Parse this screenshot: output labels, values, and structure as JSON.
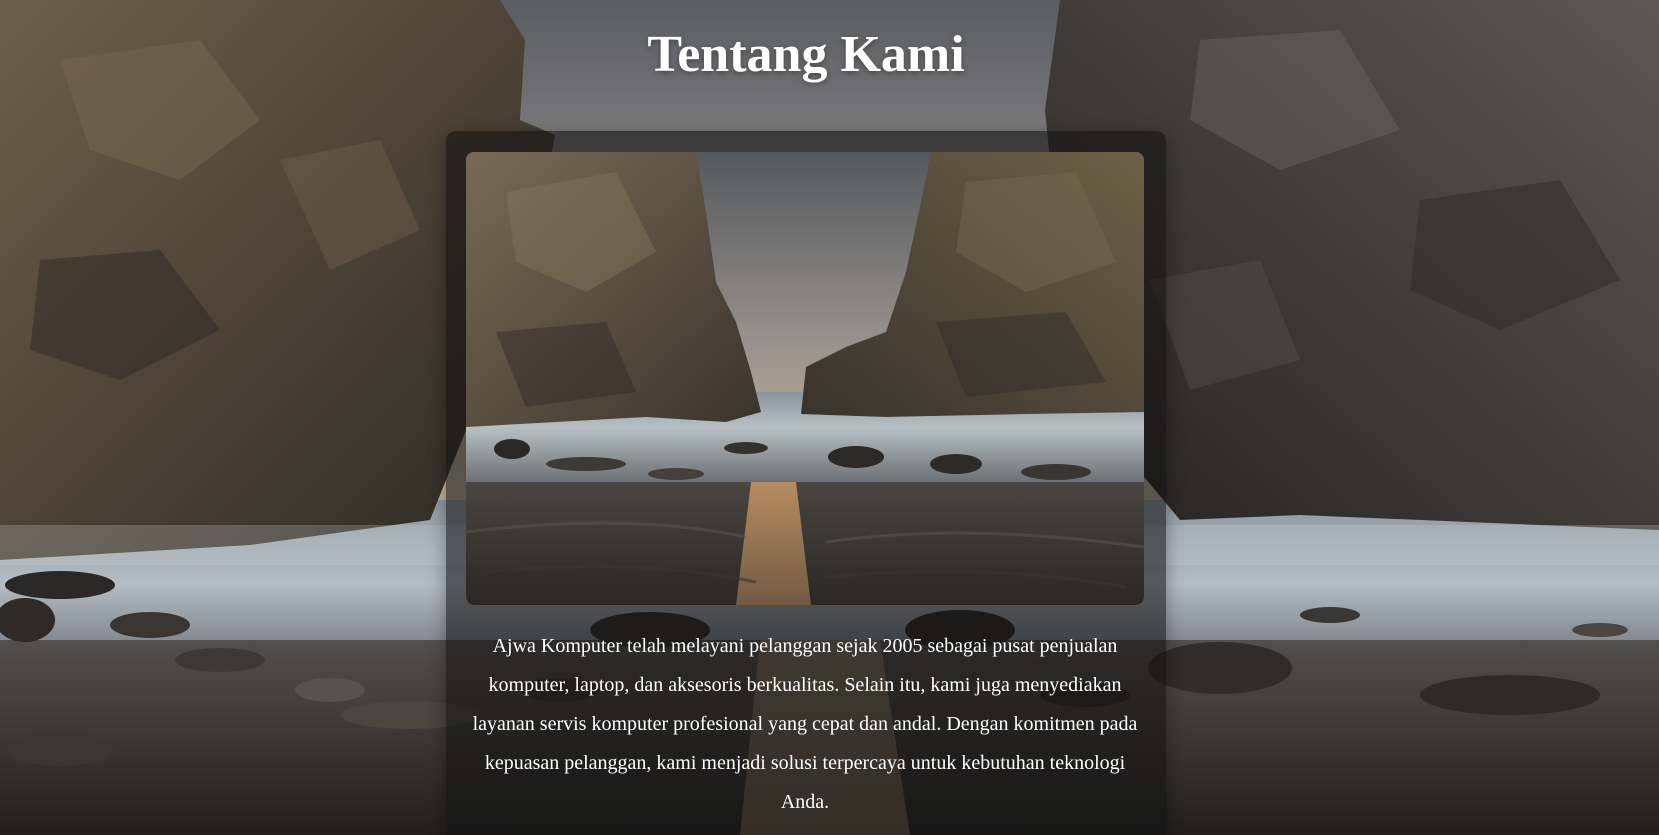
{
  "page": {
    "title": "Tentang Kami"
  },
  "about": {
    "photo_alt": "",
    "description": "Ajwa Komputer telah melayani pelanggan sejak 2005 sebagai pusat penjualan komputer, laptop, dan aksesoris berkualitas. Selain itu, kami juga menyediakan layanan servis komputer profesional yang cepat dan andal. Dengan komitmen pada kepuasan pelanggan, kami menjadi solusi terpercaya untuk kebutuhan teknologi Anda."
  },
  "colors": {
    "title_text": "#ffffff",
    "body_text": "#ffffff",
    "card_overlay": "#121212"
  }
}
